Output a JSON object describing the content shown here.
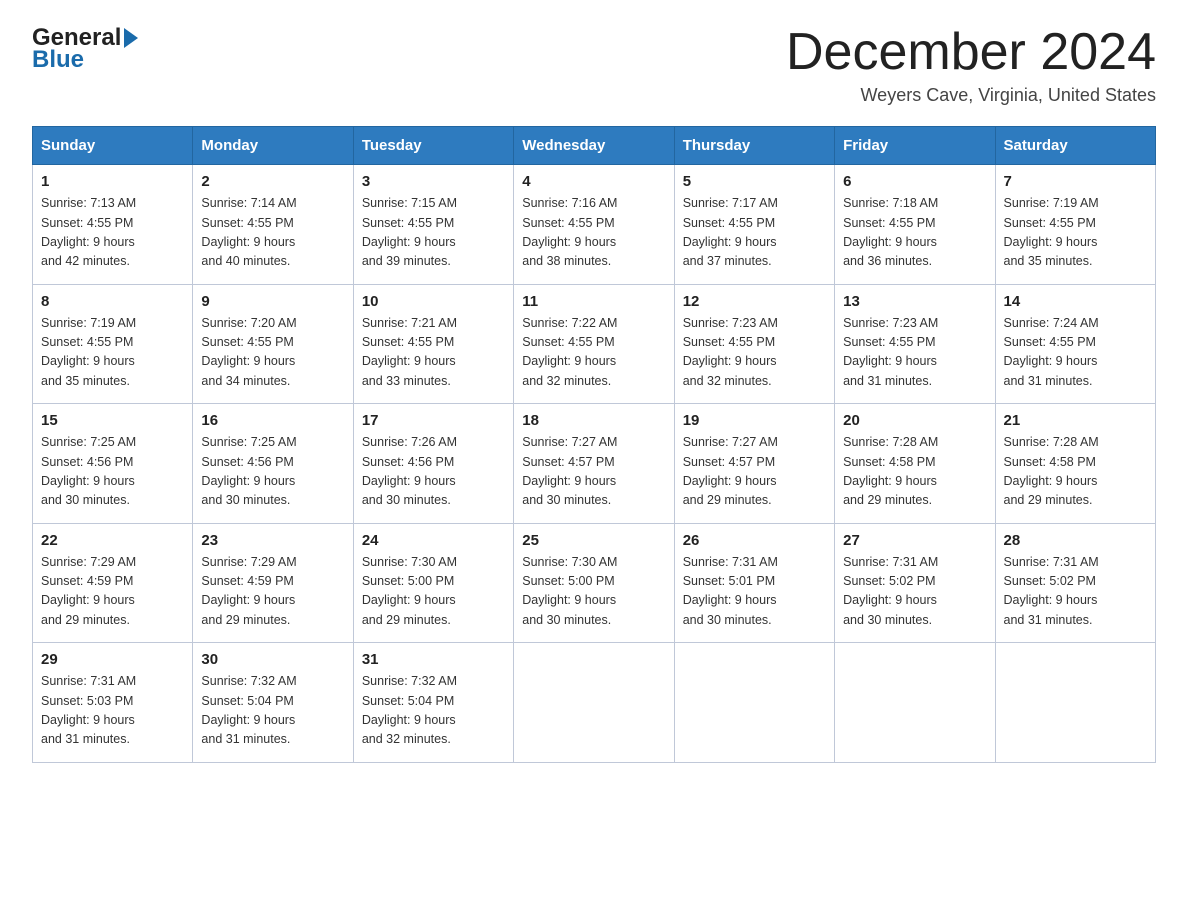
{
  "logo": {
    "general": "General",
    "blue": "Blue"
  },
  "header": {
    "title": "December 2024",
    "subtitle": "Weyers Cave, Virginia, United States"
  },
  "weekdays": [
    "Sunday",
    "Monday",
    "Tuesday",
    "Wednesday",
    "Thursday",
    "Friday",
    "Saturday"
  ],
  "weeks": [
    [
      {
        "day": "1",
        "sunrise": "7:13 AM",
        "sunset": "4:55 PM",
        "daylight": "9 hours and 42 minutes."
      },
      {
        "day": "2",
        "sunrise": "7:14 AM",
        "sunset": "4:55 PM",
        "daylight": "9 hours and 40 minutes."
      },
      {
        "day": "3",
        "sunrise": "7:15 AM",
        "sunset": "4:55 PM",
        "daylight": "9 hours and 39 minutes."
      },
      {
        "day": "4",
        "sunrise": "7:16 AM",
        "sunset": "4:55 PM",
        "daylight": "9 hours and 38 minutes."
      },
      {
        "day": "5",
        "sunrise": "7:17 AM",
        "sunset": "4:55 PM",
        "daylight": "9 hours and 37 minutes."
      },
      {
        "day": "6",
        "sunrise": "7:18 AM",
        "sunset": "4:55 PM",
        "daylight": "9 hours and 36 minutes."
      },
      {
        "day": "7",
        "sunrise": "7:19 AM",
        "sunset": "4:55 PM",
        "daylight": "9 hours and 35 minutes."
      }
    ],
    [
      {
        "day": "8",
        "sunrise": "7:19 AM",
        "sunset": "4:55 PM",
        "daylight": "9 hours and 35 minutes."
      },
      {
        "day": "9",
        "sunrise": "7:20 AM",
        "sunset": "4:55 PM",
        "daylight": "9 hours and 34 minutes."
      },
      {
        "day": "10",
        "sunrise": "7:21 AM",
        "sunset": "4:55 PM",
        "daylight": "9 hours and 33 minutes."
      },
      {
        "day": "11",
        "sunrise": "7:22 AM",
        "sunset": "4:55 PM",
        "daylight": "9 hours and 32 minutes."
      },
      {
        "day": "12",
        "sunrise": "7:23 AM",
        "sunset": "4:55 PM",
        "daylight": "9 hours and 32 minutes."
      },
      {
        "day": "13",
        "sunrise": "7:23 AM",
        "sunset": "4:55 PM",
        "daylight": "9 hours and 31 minutes."
      },
      {
        "day": "14",
        "sunrise": "7:24 AM",
        "sunset": "4:55 PM",
        "daylight": "9 hours and 31 minutes."
      }
    ],
    [
      {
        "day": "15",
        "sunrise": "7:25 AM",
        "sunset": "4:56 PM",
        "daylight": "9 hours and 30 minutes."
      },
      {
        "day": "16",
        "sunrise": "7:25 AM",
        "sunset": "4:56 PM",
        "daylight": "9 hours and 30 minutes."
      },
      {
        "day": "17",
        "sunrise": "7:26 AM",
        "sunset": "4:56 PM",
        "daylight": "9 hours and 30 minutes."
      },
      {
        "day": "18",
        "sunrise": "7:27 AM",
        "sunset": "4:57 PM",
        "daylight": "9 hours and 30 minutes."
      },
      {
        "day": "19",
        "sunrise": "7:27 AM",
        "sunset": "4:57 PM",
        "daylight": "9 hours and 29 minutes."
      },
      {
        "day": "20",
        "sunrise": "7:28 AM",
        "sunset": "4:58 PM",
        "daylight": "9 hours and 29 minutes."
      },
      {
        "day": "21",
        "sunrise": "7:28 AM",
        "sunset": "4:58 PM",
        "daylight": "9 hours and 29 minutes."
      }
    ],
    [
      {
        "day": "22",
        "sunrise": "7:29 AM",
        "sunset": "4:59 PM",
        "daylight": "9 hours and 29 minutes."
      },
      {
        "day": "23",
        "sunrise": "7:29 AM",
        "sunset": "4:59 PM",
        "daylight": "9 hours and 29 minutes."
      },
      {
        "day": "24",
        "sunrise": "7:30 AM",
        "sunset": "5:00 PM",
        "daylight": "9 hours and 29 minutes."
      },
      {
        "day": "25",
        "sunrise": "7:30 AM",
        "sunset": "5:00 PM",
        "daylight": "9 hours and 30 minutes."
      },
      {
        "day": "26",
        "sunrise": "7:31 AM",
        "sunset": "5:01 PM",
        "daylight": "9 hours and 30 minutes."
      },
      {
        "day": "27",
        "sunrise": "7:31 AM",
        "sunset": "5:02 PM",
        "daylight": "9 hours and 30 minutes."
      },
      {
        "day": "28",
        "sunrise": "7:31 AM",
        "sunset": "5:02 PM",
        "daylight": "9 hours and 31 minutes."
      }
    ],
    [
      {
        "day": "29",
        "sunrise": "7:31 AM",
        "sunset": "5:03 PM",
        "daylight": "9 hours and 31 minutes."
      },
      {
        "day": "30",
        "sunrise": "7:32 AM",
        "sunset": "5:04 PM",
        "daylight": "9 hours and 31 minutes."
      },
      {
        "day": "31",
        "sunrise": "7:32 AM",
        "sunset": "5:04 PM",
        "daylight": "9 hours and 32 minutes."
      },
      null,
      null,
      null,
      null
    ]
  ],
  "labels": {
    "sunrise": "Sunrise:",
    "sunset": "Sunset:",
    "daylight": "Daylight:"
  }
}
